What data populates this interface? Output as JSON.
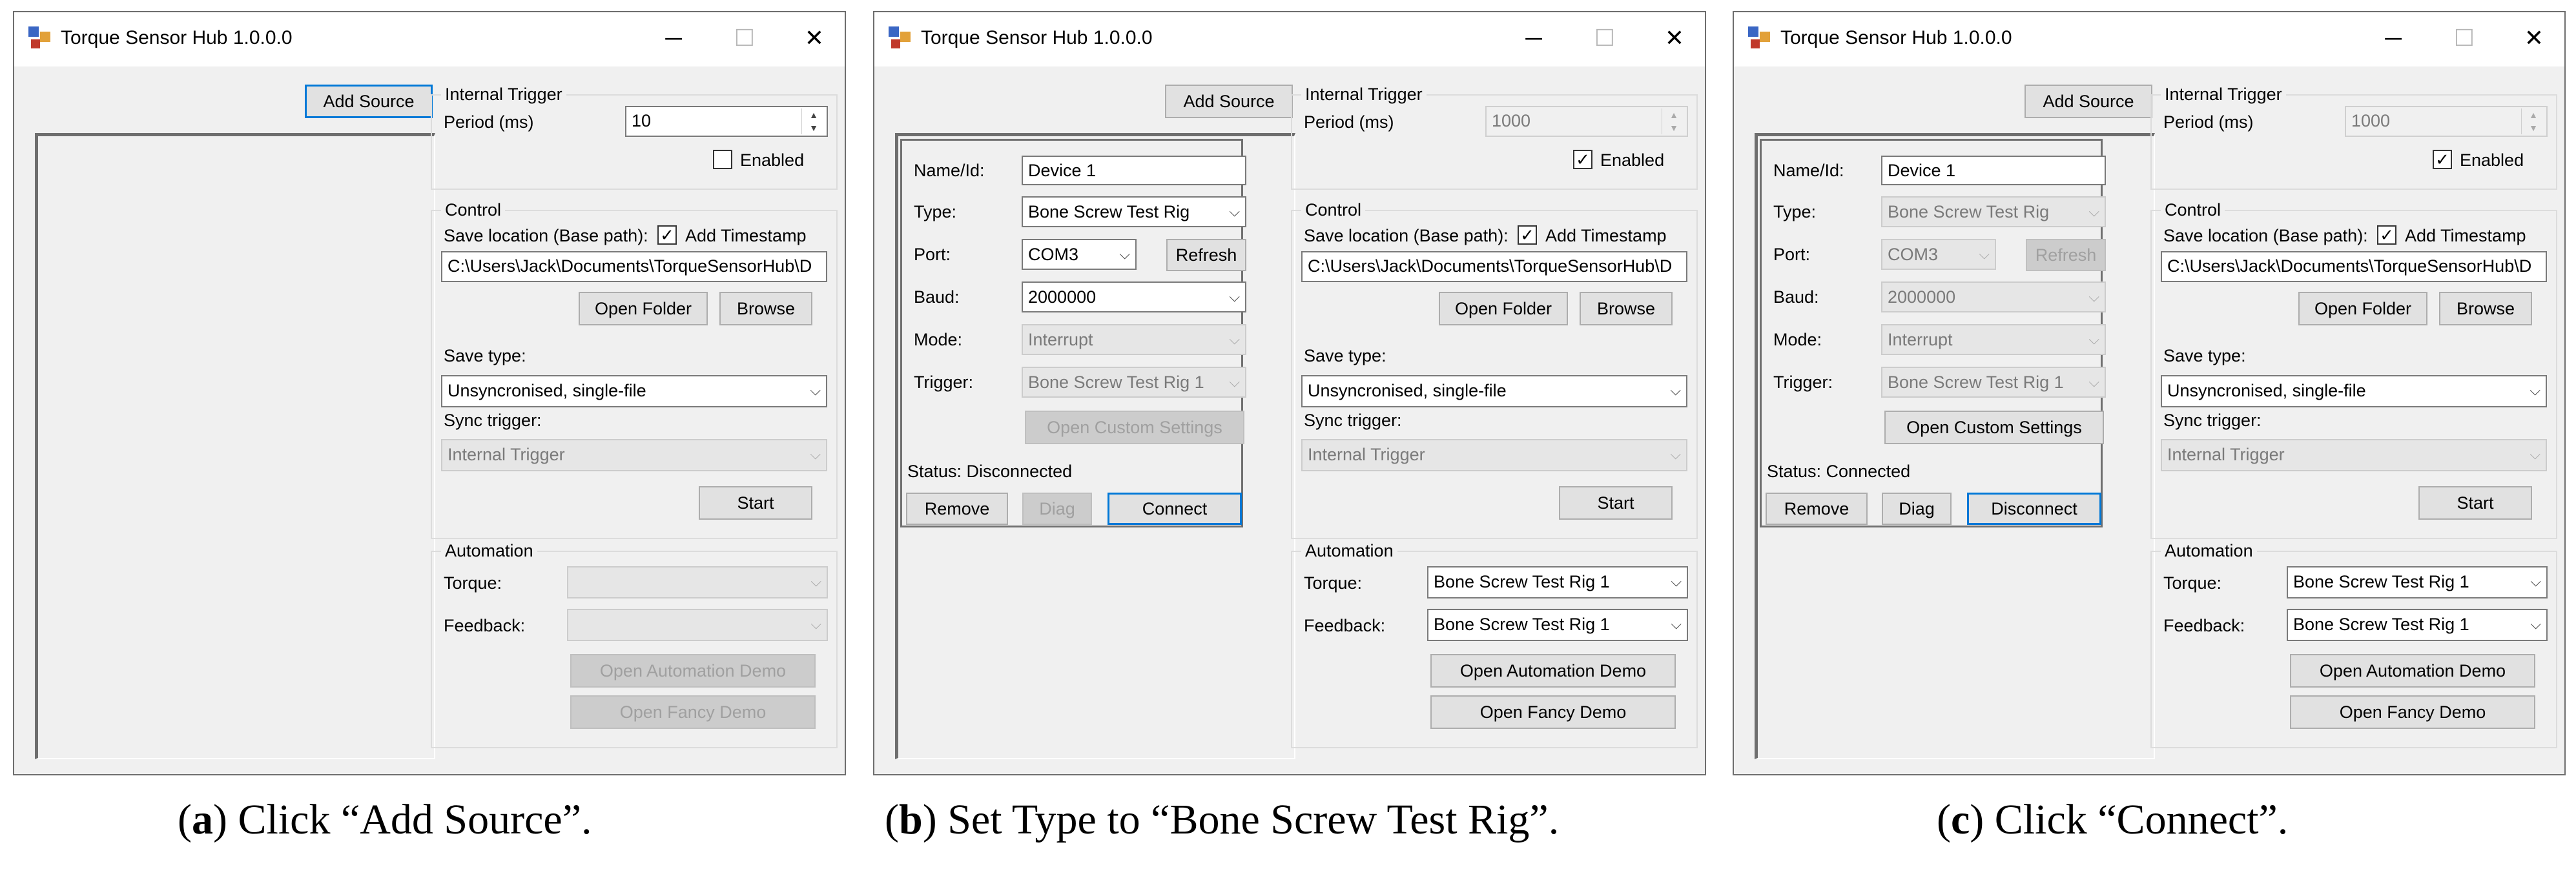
{
  "windows": [
    {
      "title": "Torque Sensor Hub 1.0.0.0",
      "add_source": "Add Source",
      "internal_trigger": {
        "title": "Internal Trigger",
        "period_label": "Period (ms)",
        "period_value": "10",
        "enabled_label": "Enabled",
        "enabled": false
      },
      "control": {
        "title": "Control",
        "save_location_label": "Save location (Base path):",
        "add_timestamp_label": "Add Timestamp",
        "path": "C:\\Users\\Jack\\Documents\\TorqueSensorHub\\D",
        "open_folder": "Open Folder",
        "browse": "Browse",
        "save_type_label": "Save type:",
        "save_type_value": "Unsyncronised, single-file",
        "sync_trigger_label": "Sync trigger:",
        "sync_trigger_value": "Internal Trigger",
        "start": "Start"
      },
      "automation": {
        "title": "Automation",
        "torque_label": "Torque:",
        "torque_value": "",
        "feedback_label": "Feedback:",
        "feedback_value": "",
        "open_automation_demo": "Open Automation Demo",
        "open_fancy_demo": "Open Fancy Demo"
      }
    },
    {
      "title": "Torque Sensor Hub 1.0.0.0",
      "add_source": "Add Source",
      "internal_trigger": {
        "title": "Internal Trigger",
        "period_label": "Period (ms)",
        "period_value": "1000",
        "enabled_label": "Enabled",
        "enabled": true
      },
      "device": {
        "name_label": "Name/Id:",
        "name_value": "Device 1",
        "type_label": "Type:",
        "type_value": "Bone Screw Test Rig",
        "port_label": "Port:",
        "port_value": "COM3",
        "refresh": "Refresh",
        "baud_label": "Baud:",
        "baud_value": "2000000",
        "mode_label": "Mode:",
        "mode_value": "Interrupt",
        "trigger_label": "Trigger:",
        "trigger_value": "Bone Screw Test Rig 1",
        "open_custom_settings": "Open Custom Settings",
        "status": "Status: Disconnected",
        "remove": "Remove",
        "diag": "Diag",
        "connect": "Connect"
      },
      "control": {
        "title": "Control",
        "save_location_label": "Save location (Base path):",
        "add_timestamp_label": "Add Timestamp",
        "path": "C:\\Users\\Jack\\Documents\\TorqueSensorHub\\D",
        "open_folder": "Open Folder",
        "browse": "Browse",
        "save_type_label": "Save type:",
        "save_type_value": "Unsyncronised, single-file",
        "sync_trigger_label": "Sync trigger:",
        "sync_trigger_value": "Internal Trigger",
        "start": "Start"
      },
      "automation": {
        "title": "Automation",
        "torque_label": "Torque:",
        "torque_value": "Bone Screw Test Rig 1",
        "feedback_label": "Feedback:",
        "feedback_value": "Bone Screw Test Rig 1",
        "open_automation_demo": "Open Automation Demo",
        "open_fancy_demo": "Open Fancy Demo"
      }
    },
    {
      "title": "Torque Sensor Hub 1.0.0.0",
      "add_source": "Add Source",
      "internal_trigger": {
        "title": "Internal Trigger",
        "period_label": "Period (ms)",
        "period_value": "1000",
        "enabled_label": "Enabled",
        "enabled": true
      },
      "device": {
        "name_label": "Name/Id:",
        "name_value": "Device 1",
        "type_label": "Type:",
        "type_value": "Bone Screw Test Rig",
        "port_label": "Port:",
        "port_value": "COM3",
        "refresh": "Refresh",
        "baud_label": "Baud:",
        "baud_value": "2000000",
        "mode_label": "Mode:",
        "mode_value": "Interrupt",
        "trigger_label": "Trigger:",
        "trigger_value": "Bone Screw Test Rig 1",
        "open_custom_settings": "Open Custom Settings",
        "status": "Status: Connected",
        "remove": "Remove",
        "diag": "Diag",
        "connect": "Disconnect"
      },
      "control": {
        "title": "Control",
        "save_location_label": "Save location (Base path):",
        "add_timestamp_label": "Add Timestamp",
        "path": "C:\\Users\\Jack\\Documents\\TorqueSensorHub\\D",
        "open_folder": "Open Folder",
        "browse": "Browse",
        "save_type_label": "Save type:",
        "save_type_value": "Unsyncronised, single-file",
        "sync_trigger_label": "Sync trigger:",
        "sync_trigger_value": "Internal Trigger",
        "start": "Start"
      },
      "automation": {
        "title": "Automation",
        "torque_label": "Torque:",
        "torque_value": "Bone Screw Test Rig 1",
        "feedback_label": "Feedback:",
        "feedback_value": "Bone Screw Test Rig 1",
        "open_automation_demo": "Open Automation Demo",
        "open_fancy_demo": "Open Fancy Demo"
      }
    }
  ],
  "captions": [
    {
      "letter": "a",
      "text": " Click “Add Source”.",
      "open": "(",
      "close": ")"
    },
    {
      "letter": "b",
      "text": " Set Type to “Bone Screw Test Rig”.",
      "open": "(",
      "close": ")"
    },
    {
      "letter": "c",
      "text": " Click “Connect”.",
      "open": "(",
      "close": ")"
    }
  ],
  "icons": {
    "app": "app-icon",
    "minimize": "minimize-icon",
    "maximize": "maximize-icon",
    "close": "close-icon",
    "dropdown": "chevron-down-icon",
    "check": "check-icon"
  },
  "colors": {
    "window_bg": "#f0f0f0",
    "focus_border": "#0078d7",
    "disabled_text": "#a0a0a0"
  }
}
